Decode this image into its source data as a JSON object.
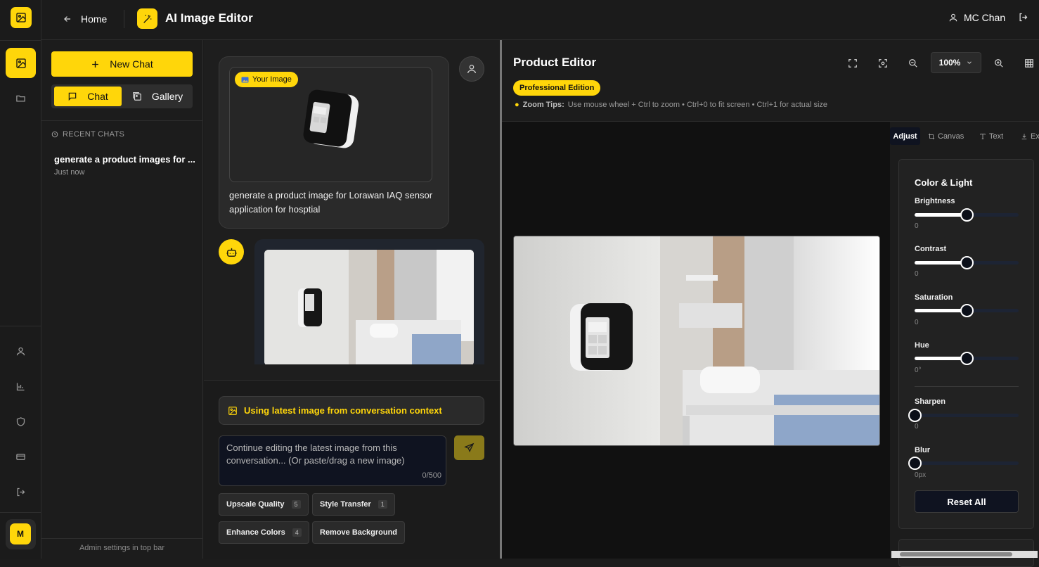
{
  "app": {
    "home_label": "Home",
    "title": "AI Image Editor",
    "user_name": "MC Chan",
    "avatar_initial": "M",
    "colors": {
      "accent": "#ffd60a",
      "background": "#1c1c1c",
      "panel": "#2a2a2a"
    }
  },
  "rail": {
    "icons": [
      "image-icon",
      "folder-icon",
      "user-icon",
      "bar-chart-icon",
      "shield-icon",
      "credit-card-icon",
      "logout-icon"
    ]
  },
  "sidebar": {
    "new_chat_label": "New Chat",
    "tabs": [
      {
        "label": "Chat",
        "active": true
      },
      {
        "label": "Gallery",
        "active": false
      }
    ],
    "recent_heading": "RECENT CHATS",
    "recent_chats": [
      {
        "title": "generate a product images for ...",
        "time": "Just now"
      }
    ],
    "footer_note": "Admin settings in top bar"
  },
  "chat": {
    "user_message": {
      "badge": "Your Image",
      "text": "generate a product image for Lorawan IAQ sensor application for hosptial"
    },
    "context_banner": "Using latest image from conversation context",
    "prompt": {
      "placeholder": "Continue editing the latest image from this conversation... (Or paste/drag a new image)",
      "char_count": "0/500"
    },
    "quick_actions": [
      {
        "label": "Upscale Quality",
        "count": "5"
      },
      {
        "label": "Style Transfer",
        "count": "1"
      },
      {
        "label": "Enhance Colors",
        "count": "4"
      },
      {
        "label": "Remove Background",
        "count": ""
      }
    ]
  },
  "editor": {
    "title": "Product Editor",
    "edition_badge": "Professional Edition",
    "zoom_tips_label": "Zoom Tips:",
    "zoom_tips_text": "Use mouse wheel + Ctrl to zoom • Ctrl+0 to fit screen • Ctrl+1 for actual size",
    "zoom_level": "100%",
    "tabs": [
      {
        "label": "Adjust",
        "active": true
      },
      {
        "label": "Canvas",
        "active": false
      },
      {
        "label": "Text",
        "active": false
      },
      {
        "label": "Ex",
        "active": false
      }
    ],
    "adjust": {
      "section_title": "Color & Light",
      "sliders": [
        {
          "label": "Brightness",
          "value": "0",
          "fraction": 0.5
        },
        {
          "label": "Contrast",
          "value": "0",
          "fraction": 0.5
        },
        {
          "label": "Saturation",
          "value": "0",
          "fraction": 0.5
        },
        {
          "label": "Hue",
          "value": "0°",
          "fraction": 0.5
        },
        {
          "label": "Sharpen",
          "value": "0",
          "fraction": 0.0
        },
        {
          "label": "Blur",
          "value": "0px",
          "fraction": 0.0
        }
      ],
      "reset_label": "Reset All"
    }
  }
}
